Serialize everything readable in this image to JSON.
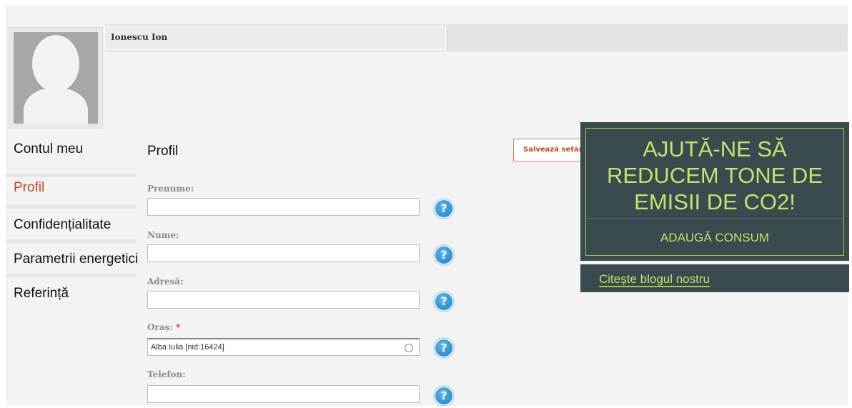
{
  "user": {
    "name": "Ionescu Ion"
  },
  "menu": {
    "items": [
      {
        "label": "Contul meu",
        "active": false
      },
      {
        "label": "Profil",
        "active": true
      },
      {
        "label": "Confidențialitate",
        "active": false
      },
      {
        "label": "Parametrii energetici",
        "active": false
      },
      {
        "label": "Referință",
        "active": false
      }
    ]
  },
  "form": {
    "title": "Profil",
    "save_label": "Salvează setările",
    "fields": [
      {
        "label": "Prenume:",
        "value": "",
        "required": false
      },
      {
        "label": "Nume:",
        "value": "",
        "required": false
      },
      {
        "label": "Adresă:",
        "value": "",
        "required": false
      },
      {
        "label": "Oraș:",
        "value": "Alba Iulia [nid:16424]",
        "required": true,
        "required_mark": "*"
      },
      {
        "label": "Telefon:",
        "value": "",
        "required": false
      }
    ],
    "help_icon": "?"
  },
  "promo": {
    "title": "AJUTĂ-NE SĂ REDUCEM TONE DE EMISII DE CO2!",
    "action": "ADAUGĂ CONSUM",
    "blog_link": "Citește blogul nostru"
  },
  "colors": {
    "accent": "#c8461e",
    "promo_bg": "#394b4e",
    "promo_text": "#c8e06a",
    "help_blue": "#1b7fc1"
  }
}
